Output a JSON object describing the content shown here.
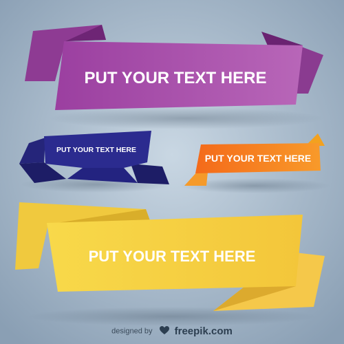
{
  "colors": {
    "background_center": "#c5d4e0",
    "background_edge": "#8da2b7",
    "purple": "#a64fa8",
    "navy": "#2b2b8f",
    "orange": "#f57c1f",
    "yellow": "#f6d94a"
  },
  "banners": [
    {
      "label": "PUT YOUR TEXT HERE",
      "color": "purple"
    },
    {
      "label": "PUT YOUR TEXT HERE",
      "color": "navy"
    },
    {
      "label": "PUT YOUR TEXT HERE",
      "color": "orange"
    },
    {
      "label": "PUT YOUR TEXT HERE",
      "color": "yellow"
    }
  ],
  "footer": {
    "credit_prefix": "designed by",
    "brand": "freepik.com",
    "logo_icon": "freepik-logo-icon"
  }
}
